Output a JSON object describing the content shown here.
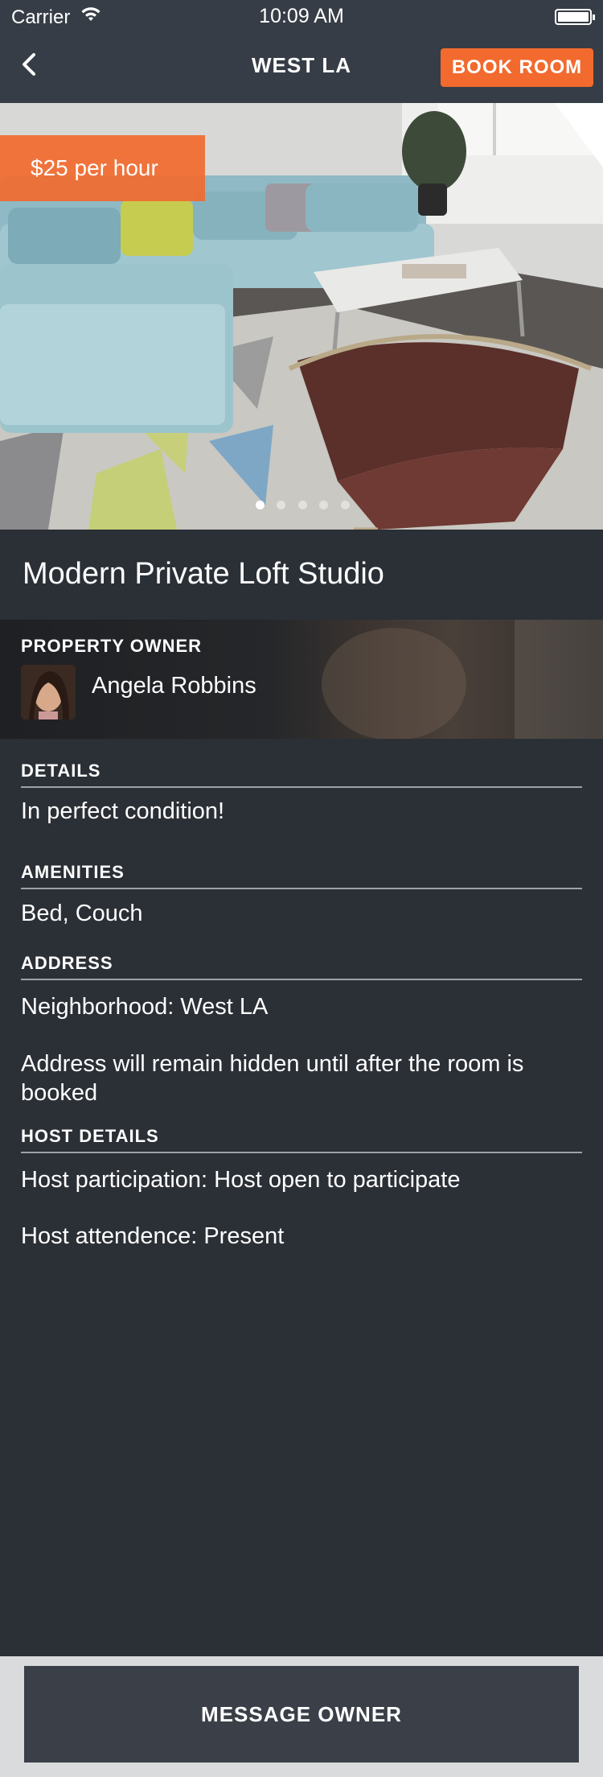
{
  "status_bar": {
    "carrier": "Carrier",
    "time": "10:09 AM"
  },
  "nav": {
    "title": "WEST LA",
    "book_label": "BOOK ROOM",
    "back_icon": "chevron-left-icon"
  },
  "hero": {
    "price": "$25 per hour",
    "page_count": 5,
    "active_page": 1
  },
  "listing": {
    "title": "Modern Private Loft Studio"
  },
  "owner": {
    "heading": "PROPERTY OWNER",
    "name": "Angela Robbins"
  },
  "details": {
    "heading": "DETAILS",
    "text": "In perfect condition!"
  },
  "amenities": {
    "heading": "AMENITIES",
    "text": "Bed, Couch"
  },
  "address": {
    "heading": "ADDRESS",
    "neighborhood": "Neighborhood: West LA",
    "note": "Address will remain hidden until after the room is booked"
  },
  "host": {
    "heading": "HOST DETAILS",
    "participation": "Host participation: Host open to participate",
    "attendance": "Host attendence: Present"
  },
  "footer": {
    "message_label": "MESSAGE OWNER"
  },
  "colors": {
    "accent": "#f26a2e",
    "background": "#2b2f36",
    "nav": "#373d46"
  }
}
